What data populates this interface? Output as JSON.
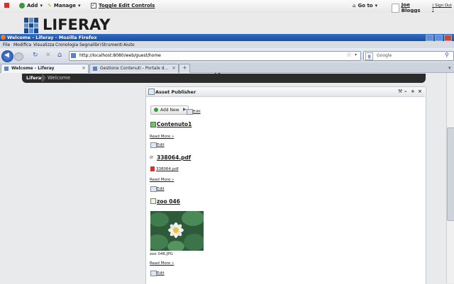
{
  "dock": {
    "add": "Add",
    "manage": "Manage",
    "toggle": "Toggle Edit Controls",
    "goto": "Go to",
    "user": "Joe Bloggs",
    "signout": "( Sign Out )"
  },
  "logo": {
    "text": "LIFERAY"
  },
  "browser": {
    "title": "Welcome - Liferay - Mozilla Firefox",
    "menu": [
      "File",
      "Modifica",
      "Visualizza",
      "Cronologia",
      "Segnalibri",
      "Strumenti",
      "Aiuto"
    ],
    "url": "http://localhost:8080/web/guest/home",
    "search_placeholder": "Google",
    "tabs": [
      {
        "label": "Welcome - Liferay"
      },
      {
        "label": "Gestione Contenuti - Portale del Comun..."
      }
    ]
  },
  "breadcrumb": {
    "root": "Liferay",
    "current": "Welcome"
  },
  "portlet": {
    "title": "Asset Publisher",
    "add_new": "Add New",
    "edit": "Edit",
    "assets": [
      {
        "title": "Contenuto1",
        "read_more": "Read More »",
        "edit": "Edit"
      },
      {
        "title": "338064.pdf",
        "file": "338064.pdf",
        "read_more": "Read More »",
        "edit": "Edit"
      },
      {
        "title": "zoo 046",
        "caption": "zoo 046.JPG",
        "read_more": "Read More »",
        "edit": "Edit"
      }
    ]
  },
  "colors": {
    "dock_bg": "#eeeeee",
    "breadcrumb_bg": "#2b2b2b",
    "firefox_title": "#2a62b8"
  }
}
